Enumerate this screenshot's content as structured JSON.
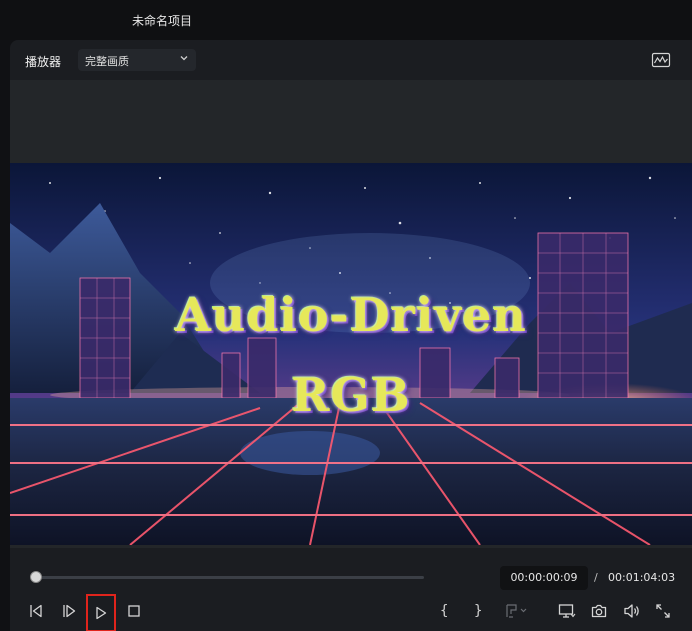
{
  "window": {
    "title": "未命名项目"
  },
  "player": {
    "label": "播放器",
    "quality": "完整画质"
  },
  "video": {
    "title_line1": "Audio-Driven",
    "title_line2": "RGB"
  },
  "playback": {
    "current_time": "00:00:00:09",
    "separator": "/",
    "total_time": "00:01:04:03",
    "progress": 0.01
  },
  "markers": {
    "in": "{",
    "out": "}"
  },
  "icons": {
    "scope": "waveform-scope-icon",
    "prev_frame": "prev-frame-icon",
    "next_frame": "next-frame-icon",
    "play": "play-icon",
    "stop": "stop-icon",
    "marker": "marker-icon",
    "display": "display-monitor-icon",
    "snapshot": "camera-icon",
    "volume": "volume-icon",
    "fullscreen": "fullscreen-icon"
  },
  "colors": {
    "highlight": "#e0241c",
    "panel": "#1b1d21",
    "title_fill": "#e6e85a"
  }
}
